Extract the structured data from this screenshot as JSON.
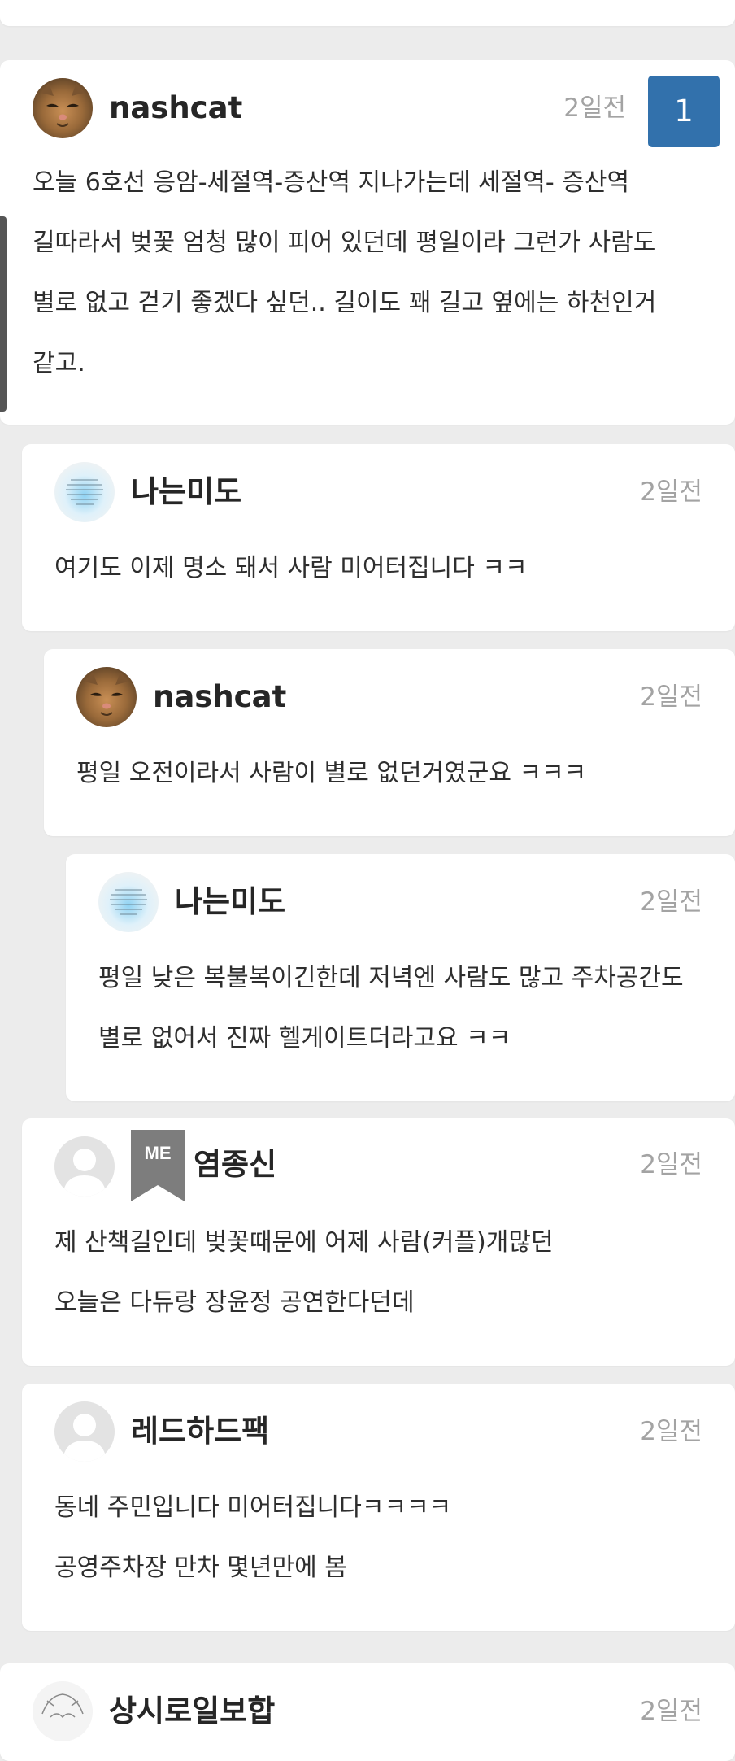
{
  "colors": {
    "background": "#ececec",
    "card": "#ffffff",
    "accent": "#3271ac",
    "date": "#a3a3a3",
    "badge": "#7d7d7d"
  },
  "comments": [
    {
      "author": "nashcat",
      "date": "2일전",
      "avatar": "cat-avatar",
      "votes": "1",
      "lines": [
        "오늘 6호선 응암-세절역-증산역 지나가는데 세절역- 증산역 길따라서 벚꽃 엄청 많이 피어 있던데 평일이라 그런가 사람도 별로 없고 걷기 좋겠다 싶던.. 길이도 꽤 길고 옆에는 하천인거 같고."
      ]
    },
    {
      "author": "나는미도",
      "date": "2일전",
      "avatar": "note-avatar",
      "lines": [
        "여기도 이제 명소 돼서 사람 미어터집니다 ㅋㅋ"
      ]
    },
    {
      "author": "nashcat",
      "date": "2일전",
      "avatar": "cat-avatar",
      "lines": [
        "평일 오전이라서 사람이 별로 없던거였군요 ㅋㅋㅋ"
      ]
    },
    {
      "author": "나는미도",
      "date": "2일전",
      "avatar": "note-avatar",
      "lines": [
        "평일 낮은 복불복이긴한데 저녁엔 사람도 많고 주차공간도 별로 없어서 진짜 헬게이트더라고요 ㅋㅋ"
      ]
    },
    {
      "author": "염종신",
      "date": "2일전",
      "avatar": "default-user-avatar",
      "badge": "ME",
      "lines": [
        "제 산책길인데 벚꽃때문에 어제 사람(커플)개많던",
        "오늘은 다듀랑 장윤정 공연한다던데"
      ]
    },
    {
      "author": "레드하드팩",
      "date": "2일전",
      "avatar": "default-user-avatar",
      "lines": [
        "동네 주민입니다 미어터집니다ㅋㅋㅋㅋ",
        "공영주차장 만차 몇년만에 봄"
      ]
    },
    {
      "author": "상시로일보합",
      "date": "2일전",
      "avatar": "sketch-avatar"
    }
  ]
}
